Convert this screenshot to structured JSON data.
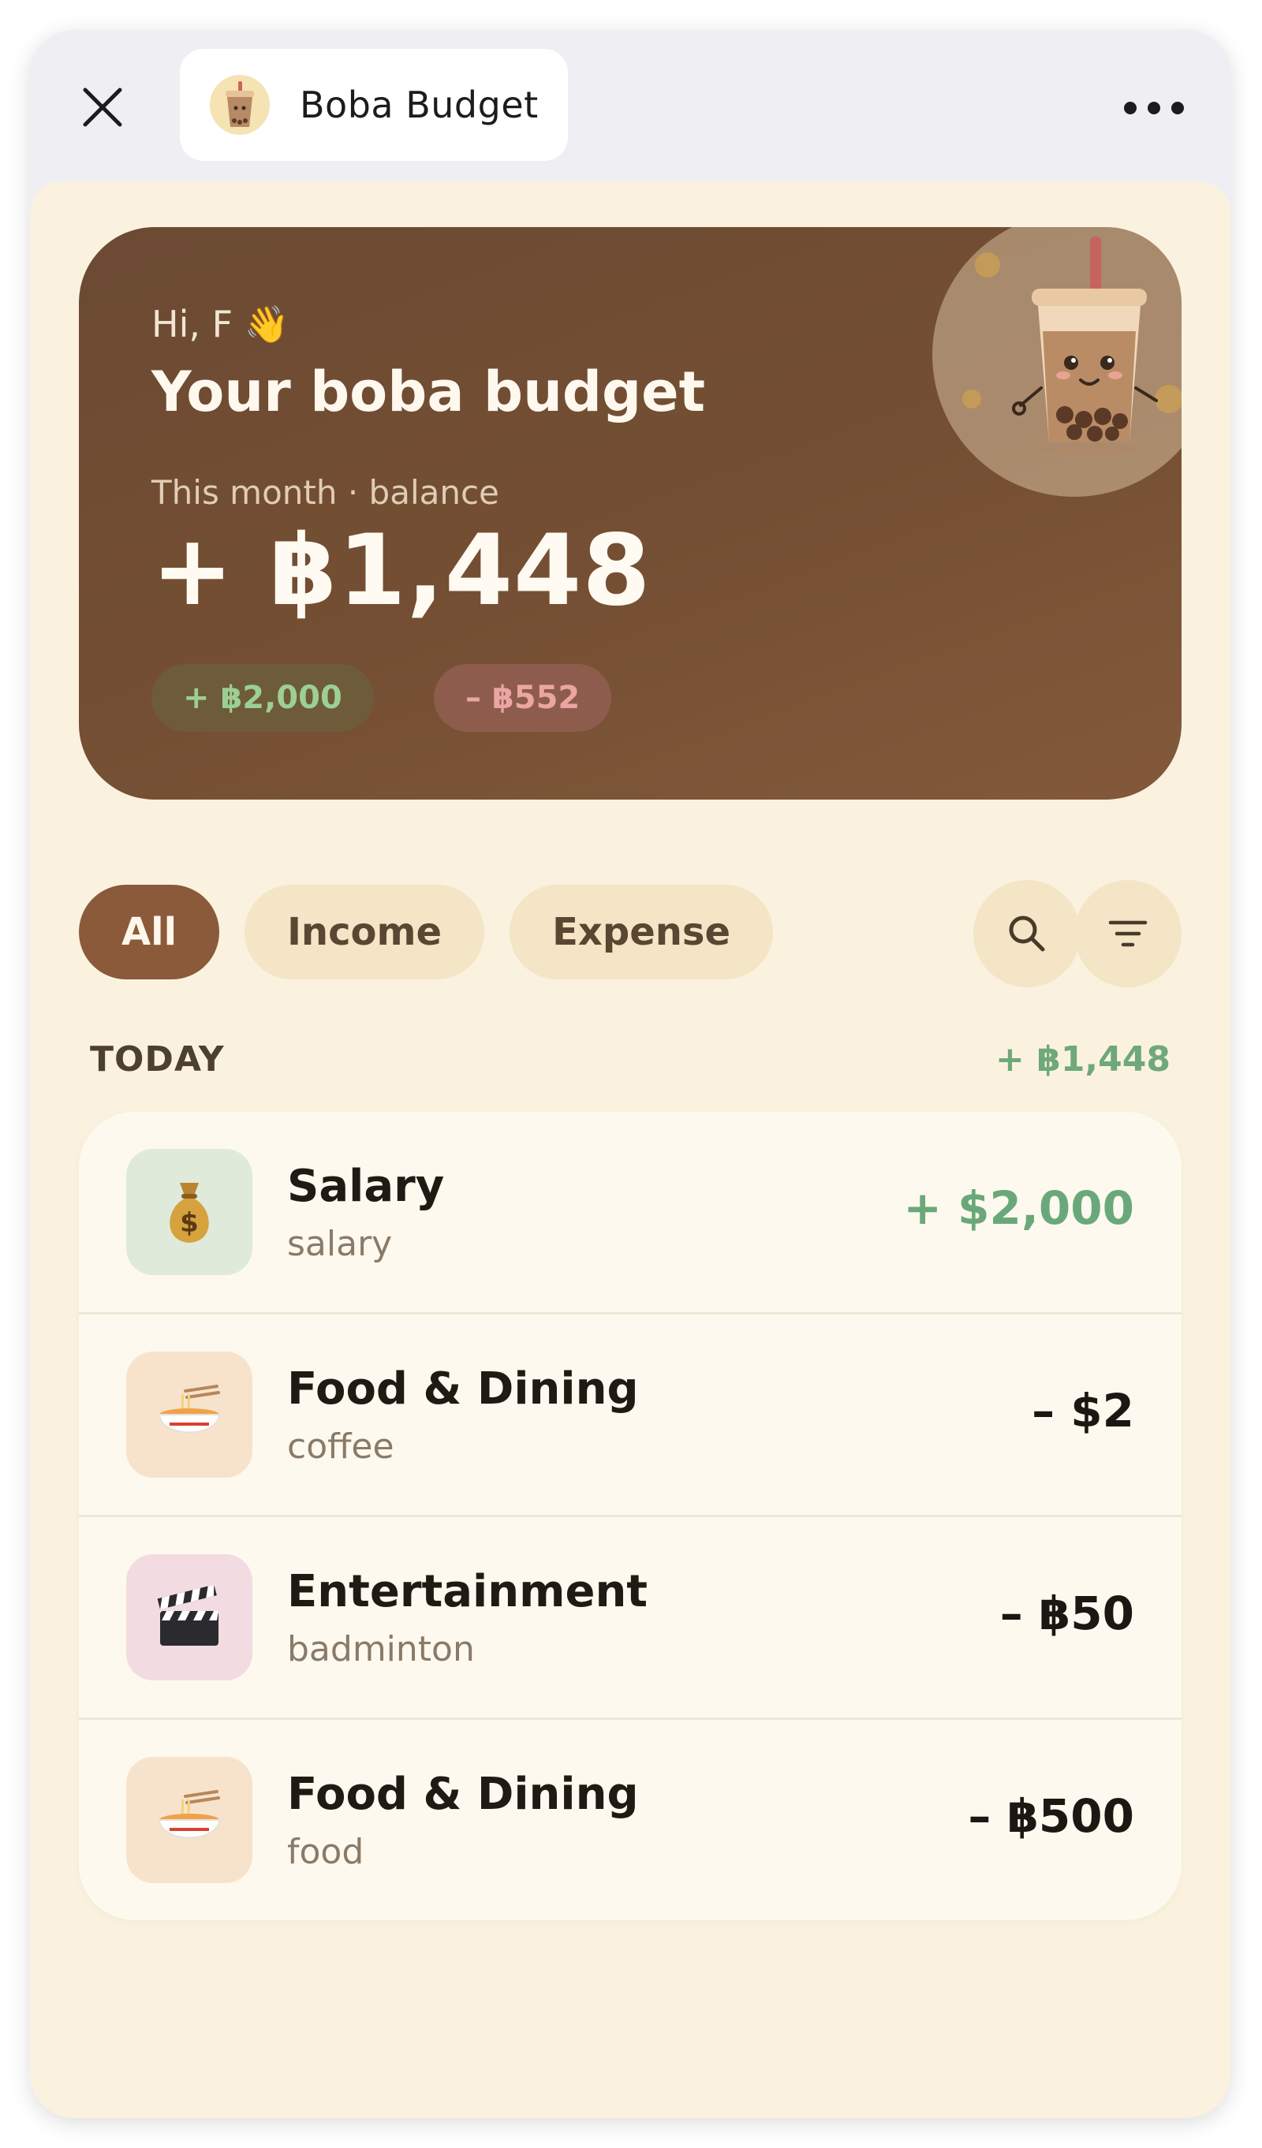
{
  "app": {
    "title": "Boba Budget"
  },
  "hero": {
    "greeting": "Hi, F 👋",
    "title": "Your boba budget",
    "subtitle": "This month · balance",
    "balance": "+ ฿1,448",
    "income_chip": "+ ฿2,000",
    "expense_chip": "– ฿552"
  },
  "filters": {
    "all": "All",
    "income": "Income",
    "expense": "Expense",
    "active": "All"
  },
  "section": {
    "title": "TODAY",
    "total": "+ ฿1,448"
  },
  "transactions": [
    {
      "title": "Salary",
      "subtitle": "salary",
      "amount": "+ $2,000",
      "type": "income",
      "icon": "money-bag-icon",
      "icon_bg": "#dfeadb"
    },
    {
      "title": "Food & Dining",
      "subtitle": "coffee",
      "amount": "– $2",
      "type": "expense",
      "icon": "noodle-bowl-icon",
      "icon_bg": "#f7e3cc"
    },
    {
      "title": "Entertainment",
      "subtitle": "badminton",
      "amount": "– ฿50",
      "type": "expense",
      "icon": "clapperboard-icon",
      "icon_bg": "#f3dbe2"
    },
    {
      "title": "Food & Dining",
      "subtitle": "food",
      "amount": "– ฿500",
      "type": "expense",
      "icon": "noodle-bowl-icon",
      "icon_bg": "#f7e3cc"
    }
  ],
  "colors": {
    "accent": "#8a5a3a",
    "background": "#faf2df",
    "income": "#6aa87a",
    "expense_chip": "#eaa6a2"
  }
}
